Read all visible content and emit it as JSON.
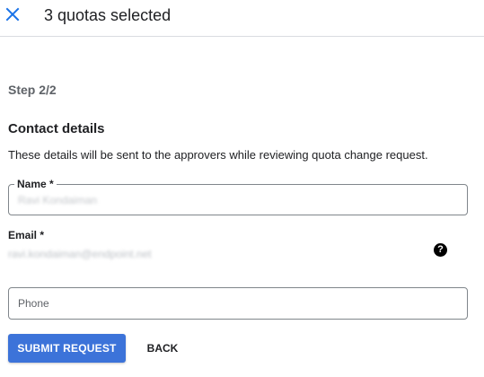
{
  "header": {
    "title": "3 quotas selected",
    "close_icon": "close-icon",
    "accent_color": "#1a73e8"
  },
  "step": {
    "label": "Step 2/2"
  },
  "contact": {
    "title": "Contact details",
    "description": "These details will be sent to the approvers while reviewing quota change request.",
    "name_label": "Name *",
    "name_value": "Ravi Kondaiman",
    "email_label": "Email *",
    "email_value": "ravi.kondaiman@endpoint.net",
    "help_icon": "help-circle-icon",
    "phone_placeholder": "Phone",
    "phone_value": ""
  },
  "actions": {
    "submit_label": "SUBMIT REQUEST",
    "back_label": "BACK",
    "submit_color": "#3c73d9"
  }
}
